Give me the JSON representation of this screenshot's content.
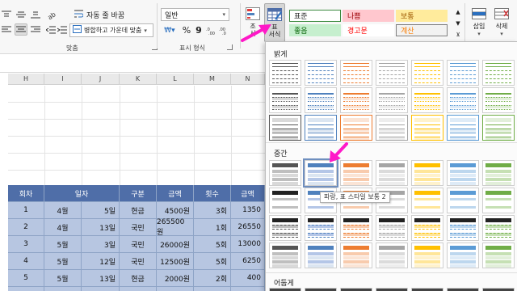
{
  "ribbon": {
    "wrap_text": "자동 줄 바꿈",
    "merge_center": "병합하고 가운데 맞춤",
    "number_format": "일반",
    "percent": "%",
    "comma": "9",
    "group_alignment": "맞춤",
    "group_number": "표시 형식",
    "cond_format_short": "조\n서",
    "format_table": "표\n서식",
    "insert": "삽입",
    "delete": "삭제",
    "styles": [
      {
        "label": "표준",
        "bg": "#ffffff",
        "border": "#3b8a3e",
        "fg": "#222222"
      },
      {
        "label": "나쁨",
        "bg": "#ffc7ce",
        "border": "transparent",
        "fg": "#9c0006"
      },
      {
        "label": "보통",
        "bg": "#ffeb9c",
        "border": "transparent",
        "fg": "#9c5700"
      },
      {
        "label": "좋음",
        "bg": "#c6efce",
        "border": "transparent",
        "fg": "#006100"
      },
      {
        "label": "경고문",
        "bg": "#ffffff",
        "border": "transparent",
        "fg": "#ff0000"
      },
      {
        "label": "계산",
        "bg": "#f2f2f2",
        "border": "#7f7f7f",
        "fg": "#fa7d00"
      }
    ]
  },
  "columns": [
    "H",
    "I",
    "J",
    "K",
    "L",
    "M",
    "N"
  ],
  "table": {
    "headers": [
      "회차",
      "일자",
      "구분",
      "금액",
      "횟수",
      "금액"
    ],
    "rows": [
      [
        "1",
        "4월",
        "5일",
        "현금",
        "4500원",
        "3회",
        "1350"
      ],
      [
        "2",
        "4월",
        "13일",
        "국민",
        "265500원",
        "1회",
        "26550"
      ],
      [
        "3",
        "5월",
        "3일",
        "국민",
        "26000원",
        "5회",
        "13000"
      ],
      [
        "4",
        "5월",
        "12일",
        "국민",
        "12500원",
        "5회",
        "6250"
      ],
      [
        "5",
        "5월",
        "13일",
        "현금",
        "2000원",
        "2회",
        "400"
      ]
    ]
  },
  "gallery": {
    "section_light": "밝게",
    "section_medium": "중간",
    "section_dark": "어둡게",
    "tooltip": "파랑, 표 스타일 보통 2"
  },
  "colors": {
    "table_header": "#4f6ea8",
    "table_body": "#b7c6e1",
    "arrow": "#ff19c8"
  }
}
